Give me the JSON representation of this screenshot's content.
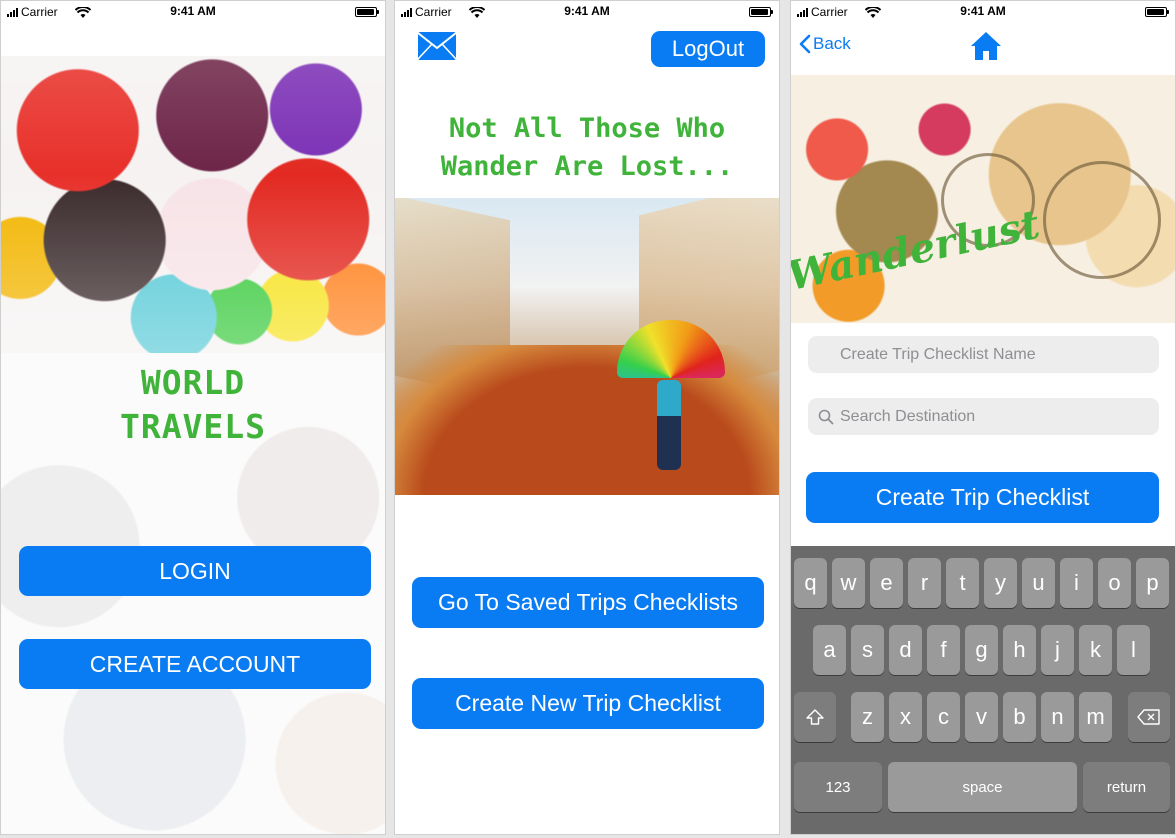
{
  "status_bar": {
    "carrier": "Carrier",
    "time": "9:41 AM"
  },
  "screen1": {
    "title_line1": "WORLD",
    "title_line2": "TRAVELS",
    "login_label": "LOGIN",
    "create_account_label": "CREATE ACCOUNT"
  },
  "screen2": {
    "mail_icon": "envelope-icon",
    "logout_label": "LogOut",
    "tagline_line1": "Not All Those Who",
    "tagline_line2": "Wander Are Lost...",
    "saved_trips_label": "Go To Saved Trips Checklists",
    "new_trip_label": "Create New Trip Checklist"
  },
  "screen3": {
    "back_label": "Back",
    "home_icon": "home-icon",
    "banner_text": "Wanderlust",
    "checklist_name_placeholder": "Create Trip Checklist Name",
    "search_placeholder": "Search Destination",
    "create_button_label": "Create Trip Checklist",
    "keyboard": {
      "row1": [
        "q",
        "w",
        "e",
        "r",
        "t",
        "y",
        "u",
        "i",
        "o",
        "p"
      ],
      "row2": [
        "a",
        "s",
        "d",
        "f",
        "g",
        "h",
        "j",
        "k",
        "l"
      ],
      "row3": [
        "z",
        "x",
        "c",
        "v",
        "b",
        "n",
        "m"
      ],
      "numbers_key": "123",
      "space_key": "space",
      "return_key": "return"
    }
  },
  "colors": {
    "accent": "#0a7cf3",
    "title_green": "#3fb33a"
  }
}
